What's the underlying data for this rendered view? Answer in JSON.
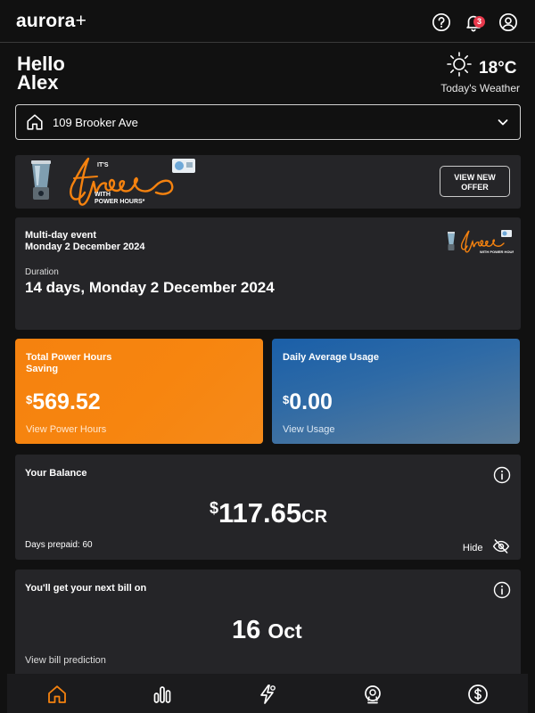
{
  "header": {
    "brand": "aurora",
    "brand_suffix": "+",
    "notification_count": "3",
    "icons": [
      "help-circle-icon",
      "bell-icon",
      "user-account-icon"
    ]
  },
  "greeting": {
    "line1": "Hello",
    "line2": "Alex"
  },
  "weather": {
    "temperature": "18°C",
    "label": "Today's Weather",
    "icon": "sun-icon"
  },
  "address_selector": {
    "value": "109 Brooker Ave",
    "icon": "home-icon"
  },
  "promo": {
    "its": "IT'S",
    "free": "free",
    "with_line1": "WITH",
    "with_line2": "POWER HOURS*",
    "button_line1": "VIEW NEW",
    "button_line2": "OFFER"
  },
  "event": {
    "title": "Multi-day event",
    "date": "Monday 2 December 2024",
    "duration_label": "Duration",
    "duration_value": "14 days, Monday 2 December 2024"
  },
  "power_hours_card": {
    "title": "Total Power Hours Saving",
    "currency": "$",
    "value": "569.52",
    "link": "View Power Hours"
  },
  "usage_card": {
    "title": "Daily Average Usage",
    "currency": "$",
    "value": "0.00",
    "link": "View Usage"
  },
  "balance": {
    "title": "Your Balance",
    "currency": "$",
    "amount": "117.65",
    "suffix": "CR",
    "days_prepaid": "Days prepaid: 60",
    "hide_label": "Hide"
  },
  "next_bill": {
    "title": "You'll get your next bill on",
    "day": "16",
    "month": "Oct",
    "link": "View bill prediction"
  },
  "bottom_nav": {
    "items": [
      "home-icon",
      "usage-bars-icon",
      "power-hours-bolt-icon",
      "rewards-icon",
      "billing-dollar-icon"
    ]
  },
  "colors": {
    "background": "#111111",
    "card": "#252528",
    "orange_card": "#f7850f",
    "blue_card": "#1a5fa8",
    "active_nav": "#f5820f",
    "badge": "#e8394c"
  }
}
